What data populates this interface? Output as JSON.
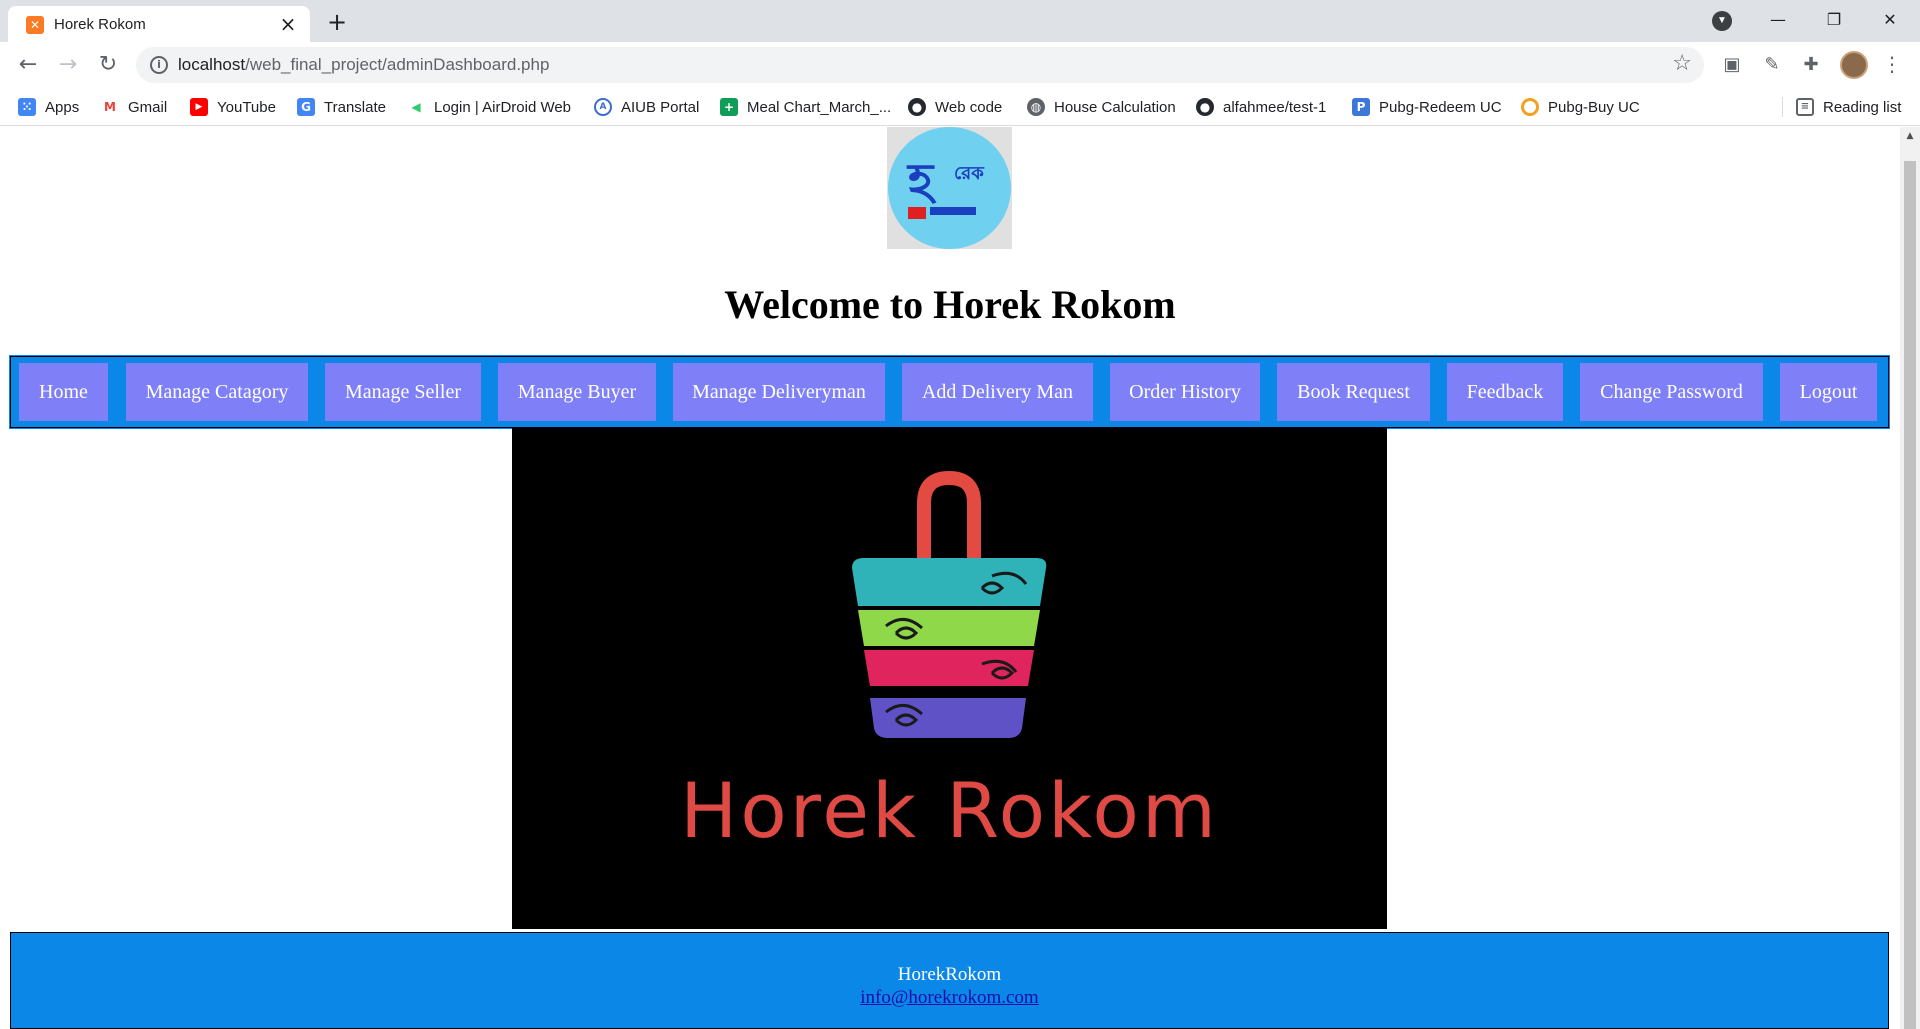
{
  "browser": {
    "tab_title": "Horek Rokom",
    "url_host": "localhost",
    "url_path": "/web_final_project/adminDashboard.php",
    "reading_list": "Reading list"
  },
  "bookmarks": [
    {
      "label": "Apps",
      "icon": "apps-grid-icon",
      "color": "#ea4335"
    },
    {
      "label": "Gmail",
      "icon": "gmail-icon",
      "color": "#ea4335"
    },
    {
      "label": "YouTube",
      "icon": "youtube-icon",
      "color": "#ff0000"
    },
    {
      "label": "Translate",
      "icon": "translate-icon",
      "color": "#4285f4"
    },
    {
      "label": "Login | AirDroid Web",
      "icon": "airdroid-icon",
      "color": "#2ecc71"
    },
    {
      "label": "AIUB Portal",
      "icon": "aiub-icon",
      "color": "#3b6bd4"
    },
    {
      "label": "Meal Chart_March_...",
      "icon": "sheets-icon",
      "color": "#0f9d58"
    },
    {
      "label": "Web code",
      "icon": "github-icon",
      "color": "#24292e"
    },
    {
      "label": "House Calculation",
      "icon": "globe-icon",
      "color": "#5f6368"
    },
    {
      "label": "alfahmee/test-1",
      "icon": "github-icon",
      "color": "#24292e"
    },
    {
      "label": "Pubg-Redeem UC",
      "icon": "pubg-icon",
      "color": "#3c78d8"
    },
    {
      "label": "Pubg-Buy UC",
      "icon": "pubg-buy-icon",
      "color": "#f4a020"
    }
  ],
  "page": {
    "heading": "Welcome to Horek Rokom",
    "hero_text": "Horek Rokom",
    "nav": [
      {
        "label": "Home"
      },
      {
        "label": "Manage Catagory"
      },
      {
        "label": "Manage Seller"
      },
      {
        "label": "Manage Buyer"
      },
      {
        "label": "Manage Deliveryman"
      },
      {
        "label": "Add Delivery Man"
      },
      {
        "label": "Order History"
      },
      {
        "label": "Book Request"
      },
      {
        "label": "Feedback"
      },
      {
        "label": "Change Password"
      },
      {
        "label": "Logout"
      }
    ],
    "footer": {
      "name": "HorekRokom",
      "email": "info@horekrokom.com"
    }
  },
  "colors": {
    "navbar_bg": "#0b87e8",
    "nav_button_bg": "#7f80f8",
    "footer_bg": "#0b87e8",
    "hero_bg": "#000000",
    "hero_text": "#e04a44"
  }
}
